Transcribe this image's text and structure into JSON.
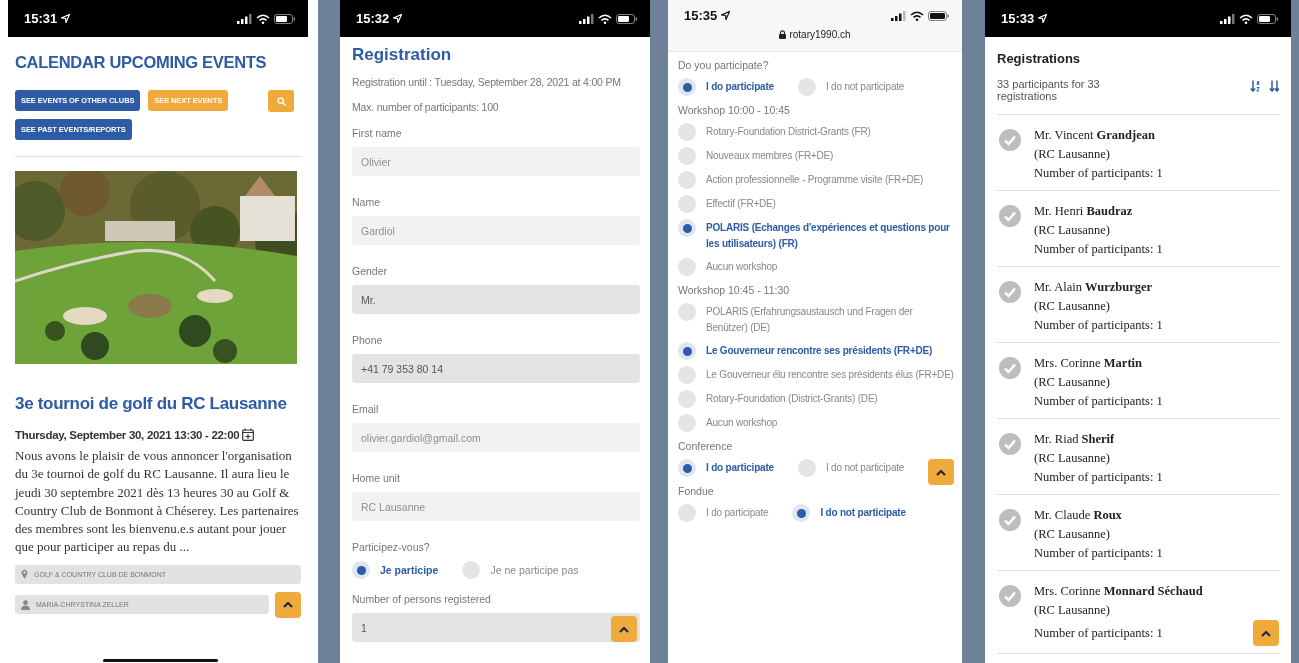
{
  "calendar_screen": {
    "status_bar": {
      "time": "15:31"
    },
    "title": "CALENDAR UPCOMING EVENTS",
    "buttons": [
      {
        "label": "SEE EVENTS OF OTHER CLUBS",
        "color": "#2d5ba6"
      },
      {
        "label": "SEE NEXT EVENTS",
        "color": "#f0a93b"
      },
      {
        "label": "SEE PAST EVENTS/REPORTS",
        "color": "#2d5ba6"
      }
    ],
    "event": {
      "title": "3e tournoi de golf du RC Lausanne",
      "date": "Thursday, September 30, 2021 13:30 - 22:00",
      "description": "Nous avons le plaisir de vous annoncer l'organisation du 3e tournoi de golf du RC Lausanne. Il aura lieu le jeudi 30 septembre 2021 dès 13 heures 30 au Golf & Country Club de Bonmont à Chéserey. Les partenaires des membres sont les bienvenu.e.s autant pour jouer que pour participer au repas du ...",
      "location": "GOLF & COUNTRY CLUB DE BONMONT",
      "organizer": "MARIA-CHRYSTINA ZELLER"
    }
  },
  "registration_screen": {
    "status_bar": {
      "time": "15:32"
    },
    "title": "Registration",
    "deadline": "Registration until : Tuesday, September 28, 2021 at 4:00 PM",
    "max_participants": "Max. number of participants: 100",
    "form_items": [
      {
        "kind": "field",
        "label": "First name",
        "value": "Olivier",
        "disabled": true
      },
      {
        "kind": "field",
        "label": "Name",
        "value": "Gardiol",
        "disabled": true
      },
      {
        "kind": "field",
        "label": "Gender",
        "value": "Mr.",
        "disabled": false
      },
      {
        "kind": "field",
        "label": "Phone",
        "value": "+41 79 353 80 14",
        "disabled": false
      },
      {
        "kind": "field",
        "label": "Email",
        "value": "olivier.gardiol@gmail.com",
        "disabled": true
      },
      {
        "kind": "field",
        "label": "Home unit",
        "value": "RC Lausanne",
        "disabled": true
      },
      {
        "kind": "radio",
        "label": "Participez-vous?",
        "options": [
          {
            "label": "Je participe",
            "selected": true
          },
          {
            "label": "Je ne participe pas",
            "selected": false
          }
        ]
      },
      {
        "kind": "field",
        "label": "Number of persons registered",
        "value": "1",
        "disabled": false
      }
    ]
  },
  "participation_screen": {
    "status_bar": {
      "time": "15:35",
      "url": "rotary1990.ch"
    },
    "questions": [
      {
        "label": "Do you participate?",
        "kind": "inline",
        "options": [
          {
            "label": "I do participate",
            "selected": true
          },
          {
            "label": "I do not participate",
            "selected": false
          }
        ]
      },
      {
        "label": "Workshop 10:00 - 10:45",
        "kind": "stacked",
        "options": [
          {
            "label": "Rotary-Foundation District-Grants (FR)",
            "selected": false
          },
          {
            "label": "Nouveaux membres (FR+DE)",
            "selected": false
          },
          {
            "label": "Action professionnelle - Programme visite (FR+DE)",
            "selected": false
          },
          {
            "label": "Effectif (FR+DE)",
            "selected": false
          },
          {
            "label": "POLARIS (Echanges d'expériences et questions pour les utilisateurs) (FR)",
            "selected": true
          },
          {
            "label": "Aucun workshop",
            "selected": false
          }
        ]
      },
      {
        "label": "Workshop 10:45 - 11:30",
        "kind": "stacked",
        "options": [
          {
            "label": "POLARIS (Erfahrungsaustausch und Fragen der Benützer) (DE)",
            "selected": false
          },
          {
            "label": "Le Gouverneur rencontre ses présidents (FR+DE)",
            "selected": true
          },
          {
            "label": "Le Gouverneur élu rencontre ses présidents élus (FR+DE)",
            "selected": false
          },
          {
            "label": "Rotary-Foundation (District-Grants) (DE)",
            "selected": false
          },
          {
            "label": "Aucun workshop",
            "selected": false
          }
        ]
      },
      {
        "label": "Conference",
        "kind": "inline",
        "options": [
          {
            "label": "I do participate",
            "selected": true
          },
          {
            "label": "I do not participate",
            "selected": false
          }
        ]
      },
      {
        "label": "Fondue",
        "kind": "inline",
        "options": [
          {
            "label": "I do participate",
            "selected": false
          },
          {
            "label": "I do not participate",
            "selected": true
          }
        ]
      }
    ]
  },
  "registrations_screen": {
    "status_bar": {
      "time": "15:33"
    },
    "title": "Registrations",
    "summary": "33 participants for 33 registrations",
    "entries": [
      {
        "name": "Mr. Vincent **Grandjean**",
        "club": "(RC Lausanne)",
        "count": "Number of participants: 1"
      },
      {
        "name": "Mr. Henri **Baudraz**",
        "club": "(RC Lausanne)",
        "count": "Number of participants: 1"
      },
      {
        "name": "Mr. Alain **Wurzburger**",
        "club": "(RC Lausanne)",
        "count": "Number of participants: 1"
      },
      {
        "name": "Mrs. Corinne **Martin**",
        "club": "(RC Lausanne)",
        "count": "Number of participants: 1"
      },
      {
        "name": "Mr. Riad **Sherif**",
        "club": "(RC Lausanne)",
        "count": "Number of participants: 1"
      },
      {
        "name": "Mr. Claude **Roux**",
        "club": "(RC Lausanne)",
        "count": "Number of participants: 1"
      },
      {
        "name": "Mrs. Corinne **Monnard Séchaud**",
        "club": "(RC Lausanne)",
        "count": "Number of participants: 1"
      }
    ]
  }
}
